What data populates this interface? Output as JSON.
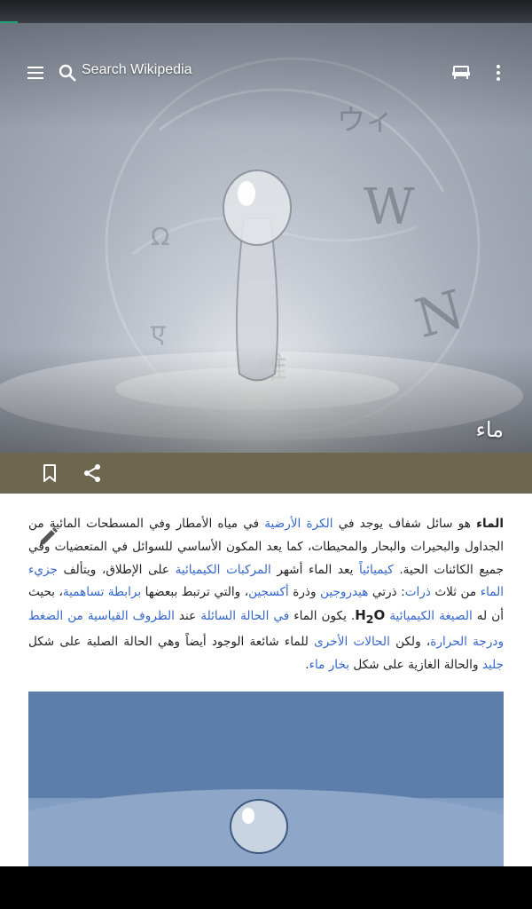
{
  "toolbar": {
    "search_placeholder": "Search Wikipedia"
  },
  "article": {
    "title": "ماء",
    "p": {
      "s1": "الماء",
      "s2": " هو سائل شفاف يوجد في ",
      "l1": "الكرة الأرضية",
      "s3": " في مياه الأمطار وفي المسطحات المائية من الجداول والبحيرات والبحار والمحيطات، كما يعد المكون الأساسي للسوائل في المتعضيات وفي جميع الكائنات الحية. ",
      "l2": "كيميائياً",
      "s4": " يعد الماء أشهر ",
      "l3": "المركبات الكيميائية",
      "s5": " على الإطلاق، ويتألف ",
      "l4": "جزيء الماء",
      "s6": " من ثلاث ",
      "l5": "ذرات",
      "s7": ": ذرتي ",
      "l6": "هيدروجين",
      "s8": " وذرة ",
      "l7": "أكسجين",
      "s9": "، والتي ترتبط ببعضها ",
      "l8": "برابطة تساهمية",
      "s10": "، بحيث أن له ",
      "l9": "الصيغة الكيميائية",
      "f1": "H",
      "f2": "2",
      "f3": "O",
      "s11": ". يكون الماء ",
      "l10": "في الحالة السائلة",
      "s12": " عند ",
      "l11": "الظروف القياسية من الضغط ودرجة الحرارة",
      "s13": "، ولكن ",
      "l12": "الحالات الأخرى",
      "s14": " للماء شائعة الوجود أيضاً وهي الحالة الصلبة على شكل ",
      "l13": "جليد",
      "s15": " والحالة الغازية على شكل ",
      "l14": "بخار ماء",
      "s16": "."
    }
  }
}
